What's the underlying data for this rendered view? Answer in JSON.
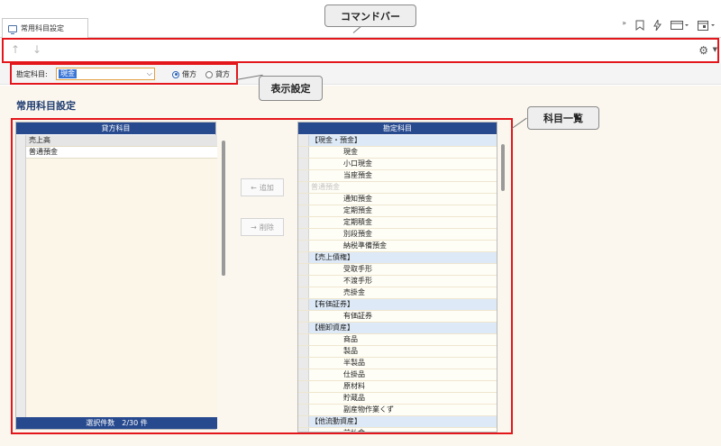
{
  "tab": {
    "title": "常用科目設定"
  },
  "top_icons": [
    "chevron-double-right-icon",
    "bookmark-icon",
    "lightning-icon",
    "window-icon",
    "calendar-icon"
  ],
  "command_bar": {
    "up": "↑",
    "down": "↓"
  },
  "settings": {
    "account_label": "勘定科目:",
    "account_value": "現金",
    "radio_debit": "借方",
    "radio_credit": "貸方",
    "selected": "借方"
  },
  "page": {
    "title": "常用科目設定"
  },
  "left_grid": {
    "header": "貸方科目",
    "rows": [
      "売上高",
      "普通預金"
    ],
    "footer": "選択件数　2/30 件"
  },
  "middle": {
    "add": "追加",
    "remove": "削除"
  },
  "right_grid": {
    "header": "勘定科目",
    "rows": [
      {
        "type": "cat",
        "text": "【現金・預金】"
      },
      {
        "type": "item",
        "text": "現金"
      },
      {
        "type": "item",
        "text": "小口現金"
      },
      {
        "type": "item",
        "text": "当座預金"
      },
      {
        "type": "dim",
        "text": "普通預金"
      },
      {
        "type": "item",
        "text": "通知預金"
      },
      {
        "type": "item",
        "text": "定期預金"
      },
      {
        "type": "item",
        "text": "定期積金"
      },
      {
        "type": "item",
        "text": "別段預金"
      },
      {
        "type": "item",
        "text": "納税準備預金"
      },
      {
        "type": "cat",
        "text": "【売上債権】"
      },
      {
        "type": "item",
        "text": "受取手形"
      },
      {
        "type": "item",
        "text": "不渡手形"
      },
      {
        "type": "item",
        "text": "売掛金"
      },
      {
        "type": "cat",
        "text": "【有価証券】"
      },
      {
        "type": "item",
        "text": "有価証券"
      },
      {
        "type": "cat",
        "text": "【棚卸資産】"
      },
      {
        "type": "item",
        "text": "商品"
      },
      {
        "type": "item",
        "text": "製品"
      },
      {
        "type": "item",
        "text": "半製品"
      },
      {
        "type": "item",
        "text": "仕掛品"
      },
      {
        "type": "item",
        "text": "原材料"
      },
      {
        "type": "item",
        "text": "貯蔵品"
      },
      {
        "type": "item",
        "text": "副産物作業くず"
      },
      {
        "type": "cat",
        "text": "【他流動資産】"
      },
      {
        "type": "item",
        "text": "前払金"
      }
    ]
  },
  "annotations": {
    "command_bar": "コマンドバー",
    "display_settings": "表示設定",
    "account_list": "科目一覧"
  },
  "colors": {
    "frame": "#e3161b",
    "header": "#274a8f",
    "accent": "#3875d7"
  }
}
